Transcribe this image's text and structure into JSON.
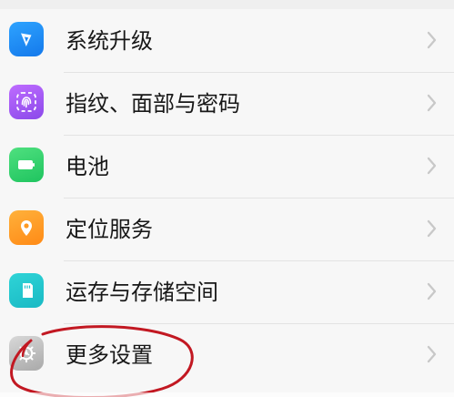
{
  "settings": {
    "items": [
      {
        "label": "系统升级",
        "icon": "system-update-icon"
      },
      {
        "label": "指纹、面部与密码",
        "icon": "fingerprint-icon"
      },
      {
        "label": "电池",
        "icon": "battery-icon"
      },
      {
        "label": "定位服务",
        "icon": "location-icon"
      },
      {
        "label": "运存与存储空间",
        "icon": "storage-icon"
      },
      {
        "label": "更多设置",
        "icon": "gear-icon"
      }
    ]
  },
  "colors": {
    "upgrade": "#1E8CFF",
    "fingerprint": "#A25BF2",
    "battery": "#2DCE6A",
    "location": "#FF991F",
    "storage": "#22C4CD",
    "gear": "#BDBDBD",
    "highlight": "#C21822"
  }
}
